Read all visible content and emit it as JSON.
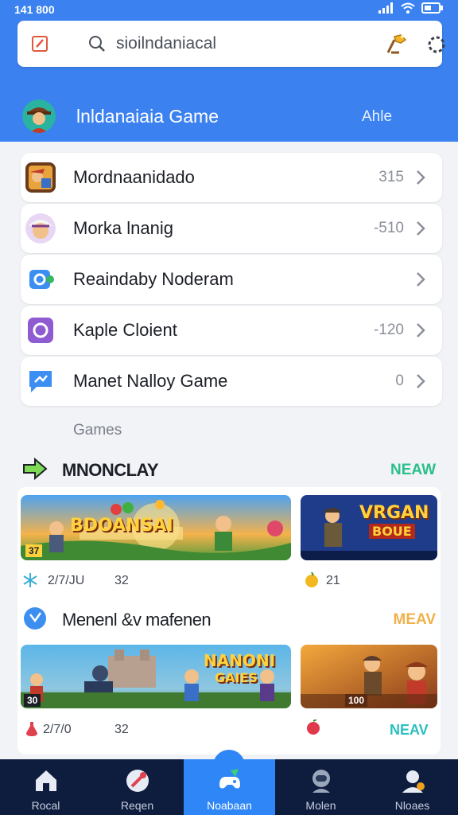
{
  "status_bar": {
    "time": "141 800"
  },
  "search": {
    "text": "sioilndaniacal"
  },
  "profile": {
    "title": "lnldanaiaia Game",
    "link": "Ahle"
  },
  "list_items": [
    {
      "label": "Mordnaanidado",
      "count": "315",
      "icon": "adventure-game-icon"
    },
    {
      "label": "Morka lnanig",
      "count": "-510",
      "icon": "character-avatar-icon"
    },
    {
      "label": "Reaindaby Noderam",
      "count": "",
      "icon": "puzzle-icon"
    },
    {
      "label": "Kaple Cloient",
      "count": "-120",
      "icon": "circle-app-icon"
    },
    {
      "label": "Manet Nalloy Game",
      "count": "0",
      "icon": "chat-icon"
    }
  ],
  "games_label": "Games",
  "section1": {
    "title": "MNONCLAY",
    "link": "NEAW",
    "link_color": "#2bbf8a"
  },
  "section2": {
    "title": "Menenl &v mafenen",
    "link": "MEAV",
    "link_color": "#f0b14a"
  },
  "banners": {
    "b1": {
      "text": "BDOANSAI",
      "badge": "37"
    },
    "b2": {
      "text_top": "VRGAN",
      "text_bottom": "BOUE"
    },
    "b3": {
      "text_top": "NANONI",
      "text_bottom": "GAIES",
      "badge": "30"
    },
    "b4": {
      "badge": "100"
    }
  },
  "stats": {
    "row1_left_a": "2/7/JU",
    "row1_left_b": "32",
    "row1_right": "21",
    "row2_left_a": "2/7/0",
    "row2_left_b": "32",
    "row2_right": "NEAV"
  },
  "nav": [
    {
      "label": "Rocal",
      "icon": "home-icon"
    },
    {
      "label": "Reqen",
      "icon": "rocket-icon"
    },
    {
      "label": "Noabaan",
      "icon": "game-controller-icon",
      "active": true
    },
    {
      "label": "Molen",
      "icon": "astronaut-icon"
    },
    {
      "label": "Nloaes",
      "icon": "profile-icon"
    }
  ],
  "colors": {
    "header_blue": "#3b82f0",
    "nav_dark": "#0e1d3e",
    "nav_active": "#2f86f6"
  }
}
